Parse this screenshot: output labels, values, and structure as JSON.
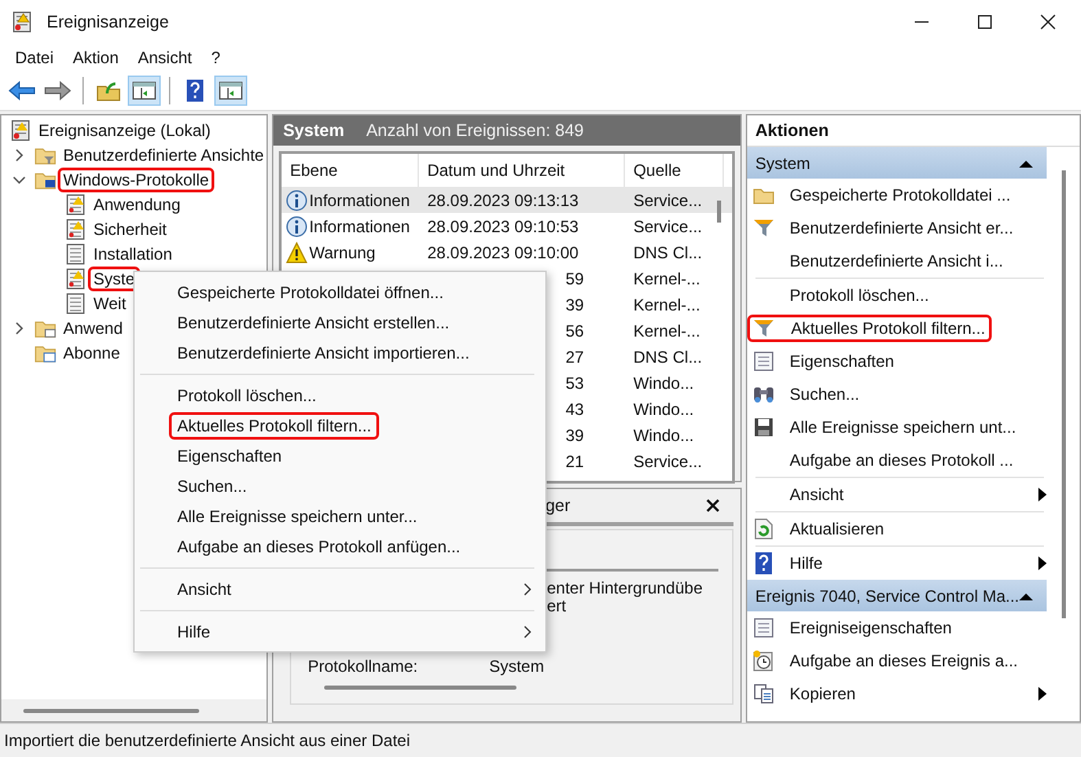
{
  "window": {
    "title": "Ereignisanzeige"
  },
  "menu": [
    "Datei",
    "Aktion",
    "Ansicht",
    "?"
  ],
  "toolbar": [
    {
      "kind": "back",
      "pressed": false
    },
    {
      "kind": "forward",
      "pressed": false
    },
    {
      "kind": "up",
      "pressed": false
    },
    {
      "kind": "pane",
      "pressed": true
    },
    {
      "kind": "help",
      "pressed": false
    },
    {
      "kind": "pane",
      "pressed": true
    }
  ],
  "tree": [
    {
      "label": "Ereignisanzeige (Lokal)",
      "kind": "root",
      "highlighted": false,
      "children": [
        {
          "label": "Benutzerdefinierte Ansichte",
          "kind": "folder-filter",
          "expanded": false,
          "highlighted": false
        },
        {
          "label": "Windows-Protokolle",
          "kind": "folder-pc",
          "expanded": true,
          "highlighted": true,
          "children": [
            {
              "label": "Anwendung",
              "kind": "log-warn",
              "highlighted": false
            },
            {
              "label": "Sicherheit",
              "kind": "log-warn",
              "highlighted": false
            },
            {
              "label": "Installation",
              "kind": "log",
              "highlighted": false
            },
            {
              "label": "Syste",
              "kind": "log-warn",
              "highlighted": true
            },
            {
              "label": "Weit",
              "kind": "log",
              "highlighted": false
            }
          ]
        },
        {
          "label": "Anwend",
          "kind": "folder",
          "expanded": false,
          "highlighted": false
        },
        {
          "label": "Abonne",
          "kind": "folder-sub",
          "highlighted": false
        }
      ]
    }
  ],
  "events": {
    "title": "System",
    "count": "Anzahl von Ereignissen: 849",
    "columns": [
      "Ebene",
      "Datum und Uhrzeit",
      "Quelle"
    ],
    "rows": [
      {
        "kind": "info",
        "level": "Informationen",
        "date": "28.09.2023 09:13:13",
        "source": "Service...",
        "selected": true
      },
      {
        "kind": "info",
        "level": "Informationen",
        "date": "28.09.2023 09:10:53",
        "source": "Service...",
        "selected": false
      },
      {
        "kind": "warning",
        "level": "Warnung",
        "date": "28.09.2023 09:10:00",
        "source": "DNS Cl...",
        "selected": false
      },
      {
        "kind": "hidden",
        "date": "59",
        "source": "Kernel-...",
        "selected": false
      },
      {
        "kind": "hidden",
        "date": "39",
        "source": "Kernel-...",
        "selected": false
      },
      {
        "kind": "hidden",
        "date": "56",
        "source": "Kernel-...",
        "selected": false
      },
      {
        "kind": "hidden",
        "date": "27",
        "source": "DNS Cl...",
        "selected": false
      },
      {
        "kind": "hidden",
        "date": "53",
        "source": "Windo...",
        "selected": false
      },
      {
        "kind": "hidden",
        "date": "43",
        "source": "Windo...",
        "selected": false
      },
      {
        "kind": "hidden",
        "date": "39",
        "source": "Windo...",
        "selected": false
      },
      {
        "kind": "hidden",
        "date": "21",
        "source": "Service...",
        "selected": false
      }
    ]
  },
  "details": {
    "title": "ger",
    "lines": [
      "enter Hintergrundübe",
      "ert"
    ],
    "fields": [
      {
        "label": "Protokollname:",
        "value": "System"
      }
    ]
  },
  "context_menu": [
    {
      "kind": "item",
      "label": "Gespeicherte Protokolldatei öffnen...",
      "submenu": false,
      "highlighted": false
    },
    {
      "kind": "item",
      "label": "Benutzerdefinierte Ansicht erstellen...",
      "submenu": false,
      "highlighted": false
    },
    {
      "kind": "item",
      "label": "Benutzerdefinierte Ansicht importieren...",
      "submenu": false,
      "highlighted": false
    },
    {
      "kind": "separator"
    },
    {
      "kind": "item",
      "label": "Protokoll löschen...",
      "submenu": false,
      "highlighted": false
    },
    {
      "kind": "item",
      "label": "Aktuelles Protokoll filtern...",
      "submenu": false,
      "highlighted": true
    },
    {
      "kind": "item",
      "label": "Eigenschaften",
      "submenu": false,
      "highlighted": false
    },
    {
      "kind": "item",
      "label": "Suchen...",
      "submenu": false,
      "highlighted": false
    },
    {
      "kind": "item",
      "label": "Alle Ereignisse speichern unter...",
      "submenu": false,
      "highlighted": false
    },
    {
      "kind": "item",
      "label": "Aufgabe an dieses Protokoll anfügen...",
      "submenu": false,
      "highlighted": false
    },
    {
      "kind": "separator"
    },
    {
      "kind": "item",
      "label": "Ansicht",
      "submenu": true,
      "highlighted": false
    },
    {
      "kind": "separator"
    },
    {
      "kind": "item",
      "label": "Hilfe",
      "submenu": true,
      "highlighted": false
    }
  ],
  "actions": {
    "title": "Aktionen",
    "sections": [
      {
        "title": "System",
        "expanded": true,
        "items": [
          {
            "kind": "folder",
            "label": "Gespeicherte Protokolldatei ...",
            "submenu": false,
            "highlighted": false
          },
          {
            "kind": "filter",
            "label": "Benutzerdefinierte Ansicht er...",
            "submenu": false,
            "highlighted": false
          },
          {
            "kind": "none",
            "label": "Benutzerdefinierte Ansicht i...",
            "submenu": false,
            "highlighted": false
          },
          {
            "kind": "separator"
          },
          {
            "kind": "none",
            "label": "Protokoll löschen...",
            "submenu": false,
            "highlighted": false
          },
          {
            "kind": "filter",
            "label": "Aktuelles Protokoll filtern...",
            "submenu": false,
            "highlighted": true
          },
          {
            "kind": "properties",
            "label": "Eigenschaften",
            "submenu": false,
            "highlighted": false
          },
          {
            "kind": "binoculars",
            "label": "Suchen...",
            "submenu": false,
            "highlighted": false
          },
          {
            "kind": "disk",
            "label": "Alle Ereignisse speichern unt...",
            "submenu": false,
            "highlighted": false
          },
          {
            "kind": "none",
            "label": "Aufgabe an dieses Protokoll ...",
            "submenu": false,
            "highlighted": false
          },
          {
            "kind": "separator"
          },
          {
            "kind": "none",
            "label": "Ansicht",
            "submenu": true,
            "highlighted": false
          },
          {
            "kind": "separator"
          },
          {
            "kind": "refresh",
            "label": "Aktualisieren",
            "submenu": false,
            "highlighted": false
          },
          {
            "kind": "separator"
          },
          {
            "kind": "help",
            "label": "Hilfe",
            "submenu": true,
            "highlighted": false
          }
        ]
      },
      {
        "title": "Ereignis 7040, Service Control Ma...",
        "expanded": true,
        "items": [
          {
            "kind": "properties",
            "label": "Ereigniseigenschaften",
            "submenu": false,
            "highlighted": false
          },
          {
            "kind": "clock",
            "label": "Aufgabe an dieses Ereignis a...",
            "submenu": false,
            "highlighted": false
          },
          {
            "kind": "copy",
            "label": "Kopieren",
            "submenu": true,
            "highlighted": false
          }
        ]
      }
    ]
  },
  "status_bar": "Importiert die benutzerdefinierte Ansicht aus einer Datei"
}
